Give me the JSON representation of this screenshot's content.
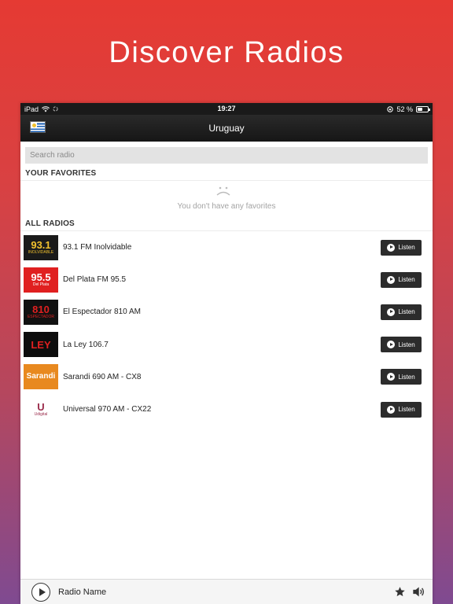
{
  "hero": {
    "title": "Discover Radios"
  },
  "statusbar": {
    "device": "iPad",
    "time": "19:27",
    "battery": "52 %",
    "battery_level": 0.52
  },
  "navbar": {
    "title": "Uruguay",
    "flag_icon": "uruguay-flag-icon"
  },
  "search": {
    "placeholder": "Search radio",
    "value": ""
  },
  "favorites": {
    "header": "YOUR FAVORITES",
    "empty_text": "You don't have any favorites",
    "empty_icon": "sad-face-icon"
  },
  "radios": {
    "header": "ALL RADIOS",
    "listen_label": "Listen",
    "items": [
      {
        "name": "93.1 FM Inolvidable",
        "logo": {
          "text": "93.1",
          "sub": "INOLVIDABLE",
          "bg": "#1a1a1a",
          "fg": "#f2c12e"
        }
      },
      {
        "name": "Del Plata FM 95.5",
        "logo": {
          "text": "95.5",
          "sub": "Del Plata",
          "bg": "#e02020",
          "fg": "#ffffff"
        }
      },
      {
        "name": "El Espectador 810 AM",
        "logo": {
          "text": "810",
          "sub": "ESPECTADOR",
          "bg": "#111111",
          "fg": "#e02020"
        }
      },
      {
        "name": "La Ley 106.7",
        "logo": {
          "text": "LEY",
          "sub": "",
          "bg": "#0d0d0d",
          "fg": "#e02020"
        }
      },
      {
        "name": "Sarandi 690 AM - CX8",
        "logo": {
          "text": "Sarandi",
          "sub": "",
          "bg": "#e8891f",
          "fg": "#ffffff"
        }
      },
      {
        "name": "Universal 970 AM - CX22",
        "logo": {
          "text": "U",
          "sub": "Udigital",
          "bg": "#ffffff",
          "fg": "#9a2a4a"
        }
      }
    ]
  },
  "player": {
    "name": "Radio Name",
    "star_icon": "star-icon",
    "volume_icon": "speaker-icon"
  },
  "colors": {
    "accent": "#2c2c2c",
    "gradient_top": "#e53a33",
    "gradient_bottom": "#7f4a91"
  }
}
